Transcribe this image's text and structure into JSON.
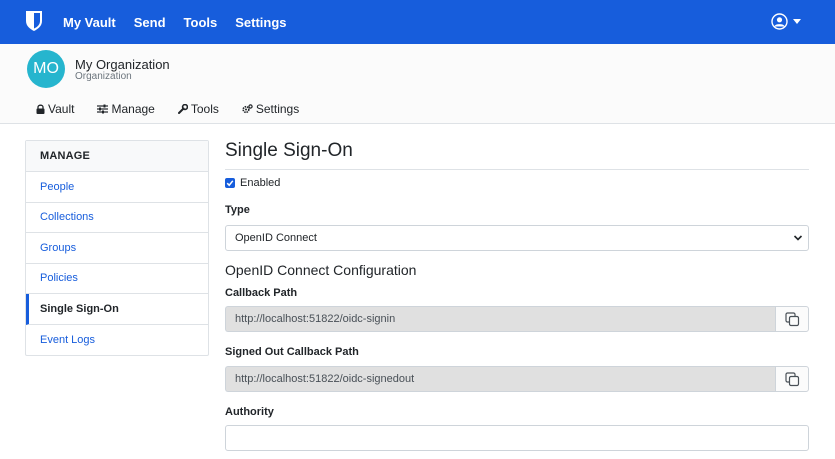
{
  "navbar": {
    "logo_icon": "shield-icon",
    "links": [
      "My Vault",
      "Send",
      "Tools",
      "Settings"
    ],
    "user_icon": "user-circle-icon",
    "bg_color": "#175ddc"
  },
  "org": {
    "avatar_initials": "MO",
    "name": "My Organization",
    "subtitle": "Organization",
    "tabs": [
      {
        "label": "Vault",
        "icon": "lock-icon"
      },
      {
        "label": "Manage",
        "icon": "sliders-icon"
      },
      {
        "label": "Tools",
        "icon": "wrench-icon"
      },
      {
        "label": "Settings",
        "icon": "gears-icon"
      }
    ]
  },
  "sidebar": {
    "heading": "MANAGE",
    "items": [
      "People",
      "Collections",
      "Groups",
      "Policies",
      "Single Sign-On",
      "Event Logs"
    ],
    "active_index": 4
  },
  "main": {
    "title": "Single Sign-On",
    "enabled_label": "Enabled",
    "enabled_checked": true,
    "type_label": "Type",
    "type_value": "OpenID Connect",
    "section_title": "OpenID Connect Configuration",
    "callback_label": "Callback Path",
    "callback_value": "http://localhost:51822/oidc-signin",
    "signed_out_label": "Signed Out Callback Path",
    "signed_out_value": "http://localhost:51822/oidc-signedout",
    "authority_label": "Authority",
    "authority_value": ""
  }
}
